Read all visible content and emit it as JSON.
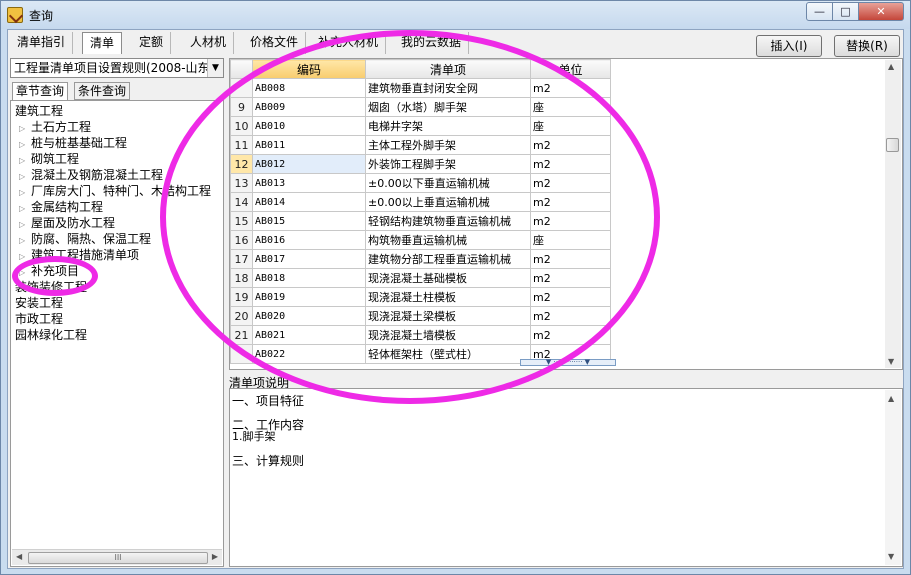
{
  "window": {
    "title": "查询"
  },
  "tabs": [
    "清单指引",
    "清单",
    "定额",
    "人材机",
    "价格文件",
    "补充人材机",
    "我的云数据"
  ],
  "active_tab": "清单",
  "actions": {
    "insert": "插入(I)",
    "replace": "替换(R)"
  },
  "left": {
    "rule_select": "工程量清单项目设置规则(2008-山东",
    "subtabs": [
      "章节查询",
      "条件查询"
    ],
    "tree": [
      {
        "label": "建筑工程",
        "level": 0
      },
      {
        "label": "土石方工程",
        "level": 1
      },
      {
        "label": "桩与桩基基础工程",
        "level": 1
      },
      {
        "label": "砌筑工程",
        "level": 1
      },
      {
        "label": "混凝土及钢筋混凝土工程",
        "level": 1
      },
      {
        "label": "厂库房大门、特种门、木结构工程",
        "level": 1
      },
      {
        "label": "金属结构工程",
        "level": 1
      },
      {
        "label": "屋面及防水工程",
        "level": 1
      },
      {
        "label": "防腐、隔热、保温工程",
        "level": 1
      },
      {
        "label": "建筑工程措施清单项",
        "level": 1
      },
      {
        "label": "补充项目",
        "level": 1
      },
      {
        "label": "装饰装修工程",
        "level": 0
      },
      {
        "label": "安装工程",
        "level": 0
      },
      {
        "label": "市政工程",
        "level": 0
      },
      {
        "label": "园林绿化工程",
        "level": 0
      }
    ],
    "hscroll_label": "III"
  },
  "grid": {
    "headers": [
      "编码",
      "清单项",
      "单位"
    ],
    "rows": [
      [
        "",
        "AB008",
        "建筑物垂直封闭安全网",
        "m2"
      ],
      [
        "9",
        "AB009",
        "烟囱（水塔）脚手架",
        "座"
      ],
      [
        "10",
        "AB010",
        "电梯井字架",
        "座"
      ],
      [
        "11",
        "AB011",
        "主体工程外脚手架",
        "m2"
      ],
      [
        "12",
        "AB012",
        "外装饰工程脚手架",
        "m2"
      ],
      [
        "13",
        "AB013",
        "±0.00以下垂直运输机械",
        "m2"
      ],
      [
        "14",
        "AB014",
        "±0.00以上垂直运输机械",
        "m2"
      ],
      [
        "15",
        "AB015",
        "轻钢结构建筑物垂直运输机械",
        "m2"
      ],
      [
        "16",
        "AB016",
        "构筑物垂直运输机械",
        "座"
      ],
      [
        "17",
        "AB017",
        "建筑物分部工程垂直运输机械",
        "m2"
      ],
      [
        "18",
        "AB018",
        "现浇混凝土基础模板",
        "m2"
      ],
      [
        "19",
        "AB019",
        "现浇混凝土柱模板",
        "m2"
      ],
      [
        "20",
        "AB020",
        "现浇混凝土梁模板",
        "m2"
      ],
      [
        "21",
        "AB021",
        "现浇混凝土墙模板",
        "m2"
      ],
      [
        "",
        "AB022",
        "轻体框架柱（壁式柱）",
        "m2"
      ]
    ],
    "selected_row": "12"
  },
  "description": {
    "label": "清单项说明",
    "lines": [
      "一、项目特征",
      "二、工作内容",
      "1.脚手架",
      "三、计算规则"
    ]
  }
}
